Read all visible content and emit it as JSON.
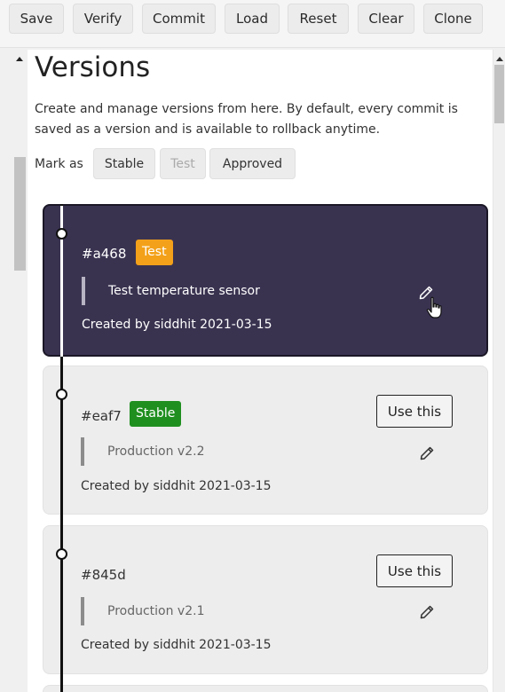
{
  "toolbar": {
    "buttons": [
      "Save",
      "Verify",
      "Commit",
      "Load",
      "Reset",
      "Clear",
      "Clone"
    ]
  },
  "page": {
    "title": "Versions",
    "description": "Create and manage versions from here. By default, every commit is saved as a version and is available to rollback anytime."
  },
  "mark_as": {
    "label": "Mark as",
    "options": [
      {
        "label": "Stable",
        "enabled": true
      },
      {
        "label": "Test",
        "enabled": false
      },
      {
        "label": "Approved",
        "enabled": true
      }
    ]
  },
  "versions": [
    {
      "hash": "#a468",
      "badge": "Test",
      "note": "Test temperature sensor",
      "created": "Created by siddhit 2021-03-15",
      "active": true
    },
    {
      "hash": "#eaf7",
      "badge": "Stable",
      "note": "Production v2.2",
      "created": "Created by siddhit 2021-03-15",
      "use_label": "Use this",
      "active": false
    },
    {
      "hash": "#845d",
      "badge": "",
      "note": "Production v2.1",
      "created": "Created by siddhit 2021-03-15",
      "use_label": "Use this",
      "active": false
    }
  ],
  "colors": {
    "active_card_bg": "#3a3350",
    "test_badge": "#f3a11a",
    "stable_badge": "#1f8f1f"
  },
  "icons": [
    "pencil-icon",
    "hand-cursor-icon"
  ]
}
